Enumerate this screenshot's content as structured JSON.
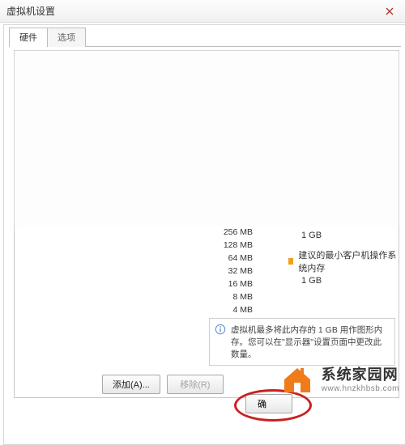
{
  "window": {
    "title": "虚拟机设置"
  },
  "tabs": {
    "hardware": "硬件",
    "options": "选项"
  },
  "memory": {
    "levels": [
      "256 MB",
      "128 MB",
      "64 MB",
      "32 MB",
      "16 MB",
      "8 MB",
      "4 MB"
    ],
    "shown_value": "1 GB",
    "rec_label": "建议的最小客户机操作系统内存",
    "rec_value": "1 GB"
  },
  "gfx_note": "虚拟机最多将此内存的 1 GB 用作图形内存。您可以在\"显示器\"设置页面中更改此数量。",
  "buttons": {
    "add": "添加(A)...",
    "remove": "移除(R)",
    "ok": "确"
  },
  "watermark": {
    "main": "系统家园网",
    "sub": "www.hnzkhbsb.com"
  }
}
